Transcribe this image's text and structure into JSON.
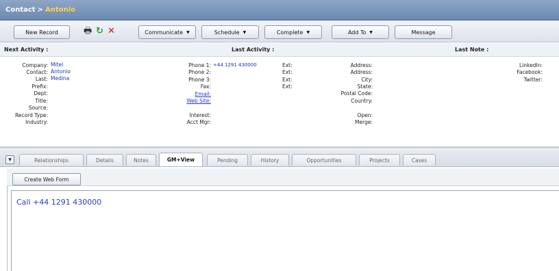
{
  "header": {
    "section": "Contact",
    "separator": ">",
    "contact_name": "Antonio"
  },
  "toolbar": {
    "new_record": "New Record",
    "icons": [
      "printer-icon",
      "refresh-icon",
      "delete-icon"
    ],
    "menus": [
      {
        "label": "Communicate"
      },
      {
        "label": "Schedule"
      },
      {
        "label": "Complete"
      },
      {
        "label": "Add To"
      }
    ],
    "message": "Message"
  },
  "infobar": {
    "next_activity": "Next Activity :",
    "last_activity": "Last Activity :",
    "last_note": "Last Note :"
  },
  "fields": {
    "col1": [
      {
        "label": "Company:",
        "value": "Mitel"
      },
      {
        "label": "Contact:",
        "value": "Antonio"
      },
      {
        "label": "Last:",
        "value": "Medina"
      },
      {
        "label": "Prefix:",
        "value": ""
      },
      {
        "label": "Dept:",
        "value": ""
      },
      {
        "label": "Title:",
        "value": ""
      },
      {
        "label": "Source:",
        "value": ""
      },
      {
        "label": "Record Type:",
        "value": ""
      },
      {
        "label": "Industry:",
        "value": ""
      }
    ],
    "col2": [
      {
        "label": "Phone 1:",
        "value": "+44 1291 430000",
        "ext": "Ext:"
      },
      {
        "label": "Phone 2:",
        "value": "",
        "ext": "Ext:"
      },
      {
        "label": "Phone 3:",
        "value": "",
        "ext": "Ext:"
      },
      {
        "label": "Fax:",
        "value": "",
        "ext": "Ext:"
      },
      {
        "label": "Email:",
        "value": ""
      },
      {
        "label": "Web Site:",
        "value": ""
      },
      {
        "label": "Interest:",
        "value": ""
      },
      {
        "label": "Acct Mgr:",
        "value": ""
      }
    ],
    "col3": [
      {
        "label": "Address:"
      },
      {
        "label": "Address:"
      },
      {
        "label": "City:"
      },
      {
        "label": "State:"
      },
      {
        "label": "Postal Code:"
      },
      {
        "label": "Country:"
      },
      {
        "label": "Open:"
      },
      {
        "label": "Merge:"
      }
    ],
    "col4": [
      {
        "label": "LinkedIn:"
      },
      {
        "label": "Facebook:"
      },
      {
        "label": "Twitter:"
      }
    ]
  },
  "tabs": [
    {
      "label": "Relationships",
      "active": false
    },
    {
      "label": "Details",
      "active": false
    },
    {
      "label": "Notes",
      "active": false
    },
    {
      "label": "GM+View",
      "active": true
    },
    {
      "label": "Pending",
      "active": false
    },
    {
      "label": "History",
      "active": false
    },
    {
      "label": "Opportunities",
      "active": false
    },
    {
      "label": "Projects",
      "active": false
    },
    {
      "label": "Cases",
      "active": false
    }
  ],
  "view": {
    "create_web_form": "Create Web Form",
    "content_text": "Call +44 1291 430000"
  }
}
